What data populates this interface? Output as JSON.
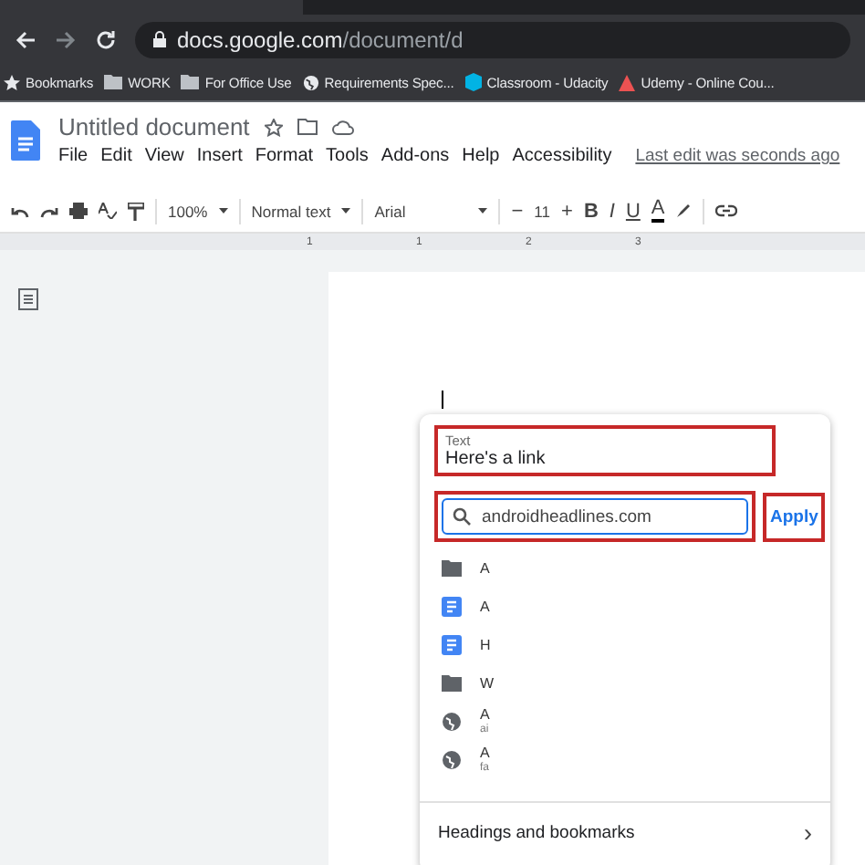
{
  "browser": {
    "url_host": "docs.google.com",
    "url_path": "/document/d",
    "bookmarks": [
      {
        "kind": "star",
        "label": "Bookmarks"
      },
      {
        "kind": "folder",
        "label": "WORK"
      },
      {
        "kind": "folder",
        "label": "For Office Use"
      },
      {
        "kind": "globe",
        "label": "Requirements Spec..."
      },
      {
        "kind": "udacity",
        "label": "Classroom - Udacity"
      },
      {
        "kind": "udemy",
        "label": "Udemy - Online Cou..."
      }
    ]
  },
  "document": {
    "title": "Untitled document",
    "menus": [
      "File",
      "Edit",
      "View",
      "Insert",
      "Format",
      "Tools",
      "Add-ons",
      "Help",
      "Accessibility"
    ],
    "last_edit": "Last edit was seconds ago"
  },
  "toolbar": {
    "zoom": "100%",
    "style": "Normal text",
    "font": "Arial",
    "size": "11",
    "minus": "−",
    "plus": "+",
    "bold": "B",
    "italic": "I",
    "underline": "U",
    "text_color": "A"
  },
  "ruler": [
    "1",
    "1",
    "2",
    "3"
  ],
  "link_dialog": {
    "text_label": "Text",
    "text_value": "Here's a link",
    "search_value": "androidheadlines.com",
    "apply": "Apply",
    "results": [
      {
        "kind": "folder",
        "title": "A"
      },
      {
        "kind": "doc",
        "title": "A"
      },
      {
        "kind": "doc",
        "title": "H"
      },
      {
        "kind": "folder",
        "title": "W"
      },
      {
        "kind": "web",
        "title": "A",
        "subtitle": "ai"
      },
      {
        "kind": "web",
        "title": "A",
        "subtitle": "fa"
      }
    ],
    "footer": "Headings and bookmarks",
    "footer_arrow": "›"
  }
}
